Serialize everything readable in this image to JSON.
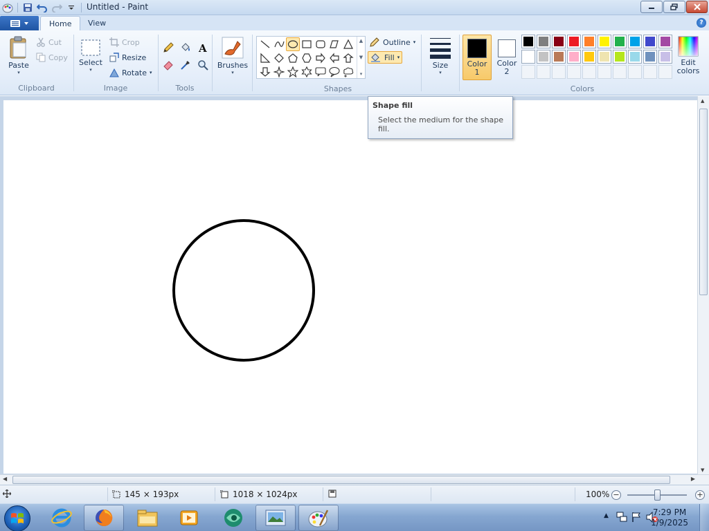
{
  "window": {
    "title": "Untitled - Paint"
  },
  "tabs": [
    {
      "label": "Home",
      "active": true
    },
    {
      "label": "View",
      "active": false
    }
  ],
  "clipboard": {
    "paste": "Paste",
    "cut": "Cut",
    "copy": "Copy",
    "group_label": "Clipboard"
  },
  "image": {
    "select": "Select",
    "crop": "Crop",
    "resize": "Resize",
    "rotate": "Rotate",
    "group_label": "Image"
  },
  "tools": {
    "group_label": "Tools",
    "items": [
      "pencil-icon",
      "fill-bucket-icon",
      "text-icon",
      "eraser-icon",
      "color-picker-icon",
      "magnifier-icon"
    ]
  },
  "brushes": {
    "label": "Brushes"
  },
  "shapes": {
    "group_label": "Shapes",
    "outline": "Outline",
    "fill": "Fill",
    "selected": "oval",
    "items": [
      "line",
      "curve",
      "oval",
      "rectangle",
      "rounded-rectangle",
      "polygon",
      "triangle",
      "right-triangle",
      "diamond",
      "pentagon",
      "hexagon",
      "right-arrow",
      "left-arrow",
      "up-arrow",
      "down-arrow",
      "four-point-star",
      "five-point-star",
      "six-point-star",
      "rounded-callout",
      "oval-callout",
      "cloud-callout"
    ]
  },
  "size": {
    "label": "Size"
  },
  "colors": {
    "group_label": "Colors",
    "color1_label_line1": "Color",
    "color1_label_line2": "1",
    "color2_label_line1": "Color",
    "color2_label_line2": "2",
    "color1": "#000000",
    "color2": "#ffffff",
    "edit_line1": "Edit",
    "edit_line2": "colors",
    "palette_row1": [
      "#000000",
      "#7f7f7f",
      "#880015",
      "#ed1c24",
      "#ff7f27",
      "#fff200",
      "#22b14c",
      "#00a2e8",
      "#3f48cc",
      "#a349a4"
    ],
    "palette_row2": [
      "#ffffff",
      "#c3c3c3",
      "#b97a57",
      "#ffaec9",
      "#ffc90e",
      "#efe4b0",
      "#b5e61d",
      "#99d9ea",
      "#7092be",
      "#c8bfe7"
    ]
  },
  "tooltip": {
    "title": "Shape fill",
    "body": "Select the medium for the shape fill."
  },
  "status": {
    "selection_size": "145 × 193px",
    "canvas_size": "1018 × 1024px",
    "zoom": "100%"
  },
  "taskbar": {
    "apps": [
      "internet-explorer-icon",
      "firefox-icon",
      "file-explorer-icon",
      "media-player-icon",
      "app-icon",
      "image-viewer-icon",
      "paint-icon"
    ],
    "time": "7:29 PM",
    "date": "1/9/2025"
  }
}
